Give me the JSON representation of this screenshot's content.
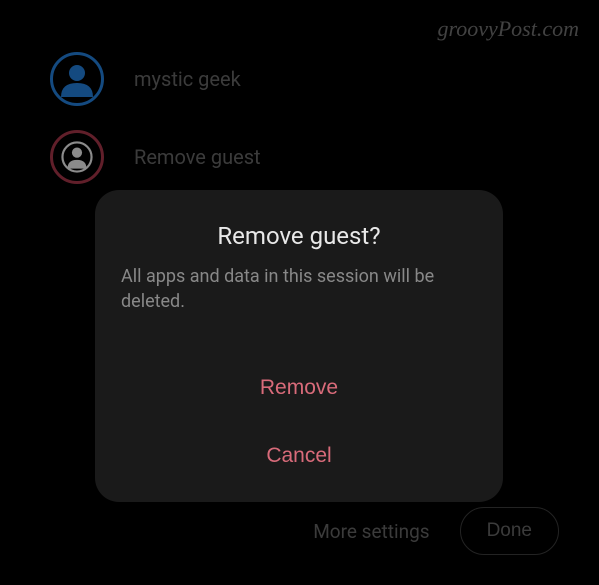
{
  "watermark": "groovyPost.com",
  "users": [
    {
      "label": "mystic geek",
      "ring": "blue",
      "fill": "#1e6bb8"
    },
    {
      "label": "Remove guest",
      "ring": "red",
      "fill": "#c8c8c8"
    }
  ],
  "footer": {
    "more_settings": "More settings",
    "done": "Done"
  },
  "dialog": {
    "title": "Remove guest?",
    "body": "All apps and data in this session will be deleted.",
    "remove": "Remove",
    "cancel": "Cancel"
  }
}
